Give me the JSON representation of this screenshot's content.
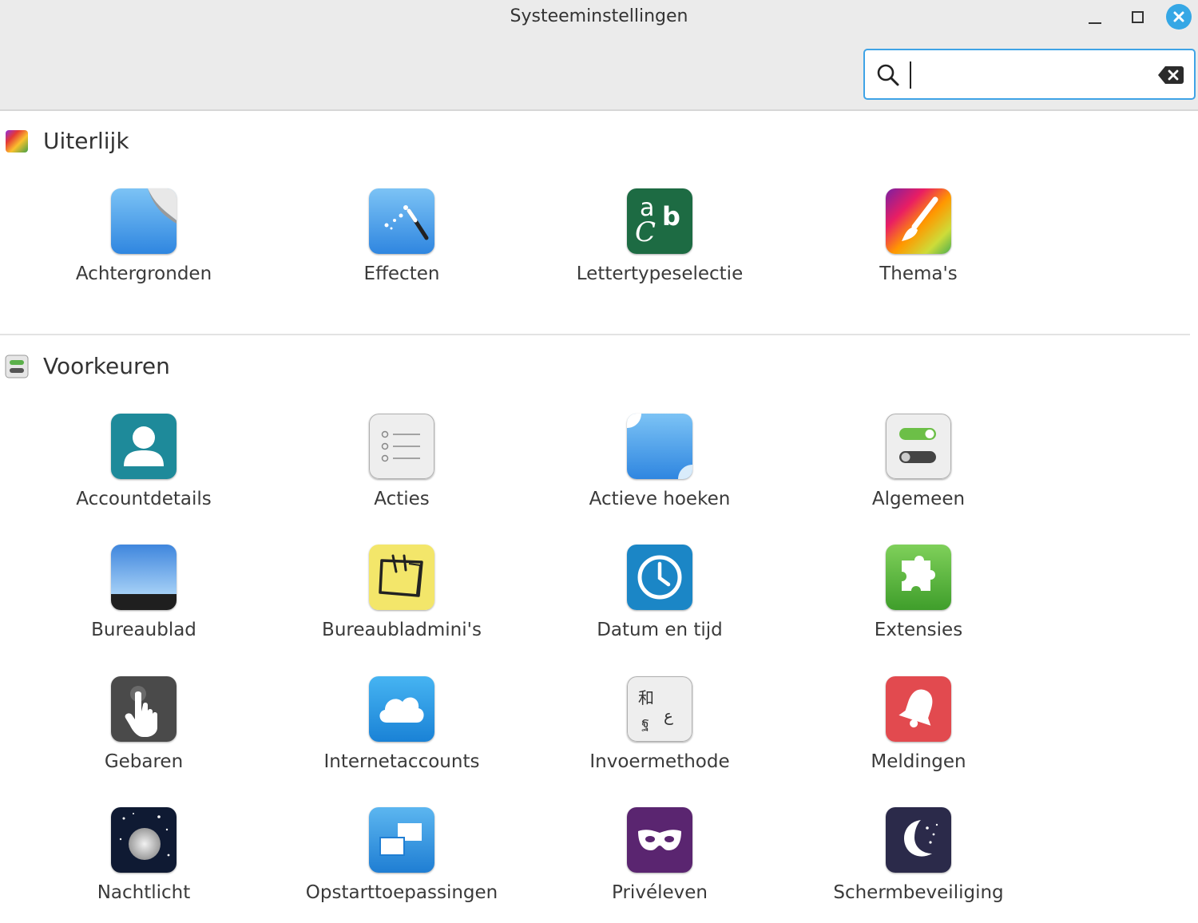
{
  "window": {
    "title": "Systeeminstellingen",
    "minimize_icon": "minimize-icon",
    "maximize_icon": "maximize-icon",
    "close_icon": "close-icon",
    "close_color": "#35a7e5"
  },
  "search": {
    "value": "",
    "placeholder": "",
    "icon": "search-icon",
    "clear_icon": "clear-text-icon",
    "focus_color": "#3ea3e6"
  },
  "sections": [
    {
      "label": "Uiterlijk",
      "icon": "appearance-icon",
      "items": [
        {
          "label": "Achtergronden",
          "icon": "backgrounds-icon"
        },
        {
          "label": "Effecten",
          "icon": "effects-icon"
        },
        {
          "label": "Lettertypeselectie",
          "icon": "font-selection-icon"
        },
        {
          "label": "Thema's",
          "icon": "themes-icon"
        }
      ]
    },
    {
      "label": "Voorkeuren",
      "icon": "preferences-icon",
      "items": [
        {
          "label": "Accountdetails",
          "icon": "account-details-icon"
        },
        {
          "label": "Acties",
          "icon": "actions-icon"
        },
        {
          "label": "Actieve hoeken",
          "icon": "hot-corners-icon"
        },
        {
          "label": "Algemeen",
          "icon": "general-icon"
        },
        {
          "label": "Bureaublad",
          "icon": "desktop-icon"
        },
        {
          "label": "Bureaubladmini's",
          "icon": "desklets-icon"
        },
        {
          "label": "Datum en tijd",
          "icon": "date-time-icon"
        },
        {
          "label": "Extensies",
          "icon": "extensions-icon"
        },
        {
          "label": "Gebaren",
          "icon": "gestures-icon"
        },
        {
          "label": "Internetaccounts",
          "icon": "online-accounts-icon"
        },
        {
          "label": "Invoermethode",
          "icon": "input-method-icon"
        },
        {
          "label": "Meldingen",
          "icon": "notifications-icon"
        },
        {
          "label": "Nachtlicht",
          "icon": "night-light-icon"
        },
        {
          "label": "Opstarttoepassingen",
          "icon": "startup-applications-icon"
        },
        {
          "label": "Privéleven",
          "icon": "privacy-icon"
        },
        {
          "label": "Schermbeveiliging",
          "icon": "screensaver-icon"
        }
      ]
    }
  ]
}
